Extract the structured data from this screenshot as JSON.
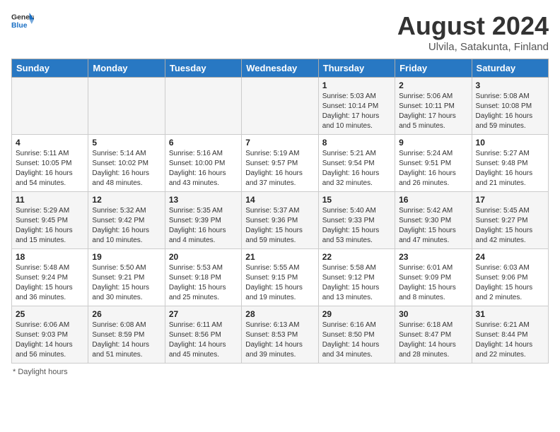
{
  "header": {
    "logo_general": "General",
    "logo_blue": "Blue",
    "title": "August 2024",
    "subtitle": "Ulvila, Satakunta, Finland"
  },
  "days_of_week": [
    "Sunday",
    "Monday",
    "Tuesday",
    "Wednesday",
    "Thursday",
    "Friday",
    "Saturday"
  ],
  "footer": {
    "daylight_hours_label": "Daylight hours"
  },
  "weeks": [
    [
      {
        "num": "",
        "info": ""
      },
      {
        "num": "",
        "info": ""
      },
      {
        "num": "",
        "info": ""
      },
      {
        "num": "",
        "info": ""
      },
      {
        "num": "1",
        "info": "Sunrise: 5:03 AM\nSunset: 10:14 PM\nDaylight: 17 hours\nand 10 minutes."
      },
      {
        "num": "2",
        "info": "Sunrise: 5:06 AM\nSunset: 10:11 PM\nDaylight: 17 hours\nand 5 minutes."
      },
      {
        "num": "3",
        "info": "Sunrise: 5:08 AM\nSunset: 10:08 PM\nDaylight: 16 hours\nand 59 minutes."
      }
    ],
    [
      {
        "num": "4",
        "info": "Sunrise: 5:11 AM\nSunset: 10:05 PM\nDaylight: 16 hours\nand 54 minutes."
      },
      {
        "num": "5",
        "info": "Sunrise: 5:14 AM\nSunset: 10:02 PM\nDaylight: 16 hours\nand 48 minutes."
      },
      {
        "num": "6",
        "info": "Sunrise: 5:16 AM\nSunset: 10:00 PM\nDaylight: 16 hours\nand 43 minutes."
      },
      {
        "num": "7",
        "info": "Sunrise: 5:19 AM\nSunset: 9:57 PM\nDaylight: 16 hours\nand 37 minutes."
      },
      {
        "num": "8",
        "info": "Sunrise: 5:21 AM\nSunset: 9:54 PM\nDaylight: 16 hours\nand 32 minutes."
      },
      {
        "num": "9",
        "info": "Sunrise: 5:24 AM\nSunset: 9:51 PM\nDaylight: 16 hours\nand 26 minutes."
      },
      {
        "num": "10",
        "info": "Sunrise: 5:27 AM\nSunset: 9:48 PM\nDaylight: 16 hours\nand 21 minutes."
      }
    ],
    [
      {
        "num": "11",
        "info": "Sunrise: 5:29 AM\nSunset: 9:45 PM\nDaylight: 16 hours\nand 15 minutes."
      },
      {
        "num": "12",
        "info": "Sunrise: 5:32 AM\nSunset: 9:42 PM\nDaylight: 16 hours\nand 10 minutes."
      },
      {
        "num": "13",
        "info": "Sunrise: 5:35 AM\nSunset: 9:39 PM\nDaylight: 16 hours\nand 4 minutes."
      },
      {
        "num": "14",
        "info": "Sunrise: 5:37 AM\nSunset: 9:36 PM\nDaylight: 15 hours\nand 59 minutes."
      },
      {
        "num": "15",
        "info": "Sunrise: 5:40 AM\nSunset: 9:33 PM\nDaylight: 15 hours\nand 53 minutes."
      },
      {
        "num": "16",
        "info": "Sunrise: 5:42 AM\nSunset: 9:30 PM\nDaylight: 15 hours\nand 47 minutes."
      },
      {
        "num": "17",
        "info": "Sunrise: 5:45 AM\nSunset: 9:27 PM\nDaylight: 15 hours\nand 42 minutes."
      }
    ],
    [
      {
        "num": "18",
        "info": "Sunrise: 5:48 AM\nSunset: 9:24 PM\nDaylight: 15 hours\nand 36 minutes."
      },
      {
        "num": "19",
        "info": "Sunrise: 5:50 AM\nSunset: 9:21 PM\nDaylight: 15 hours\nand 30 minutes."
      },
      {
        "num": "20",
        "info": "Sunrise: 5:53 AM\nSunset: 9:18 PM\nDaylight: 15 hours\nand 25 minutes."
      },
      {
        "num": "21",
        "info": "Sunrise: 5:55 AM\nSunset: 9:15 PM\nDaylight: 15 hours\nand 19 minutes."
      },
      {
        "num": "22",
        "info": "Sunrise: 5:58 AM\nSunset: 9:12 PM\nDaylight: 15 hours\nand 13 minutes."
      },
      {
        "num": "23",
        "info": "Sunrise: 6:01 AM\nSunset: 9:09 PM\nDaylight: 15 hours\nand 8 minutes."
      },
      {
        "num": "24",
        "info": "Sunrise: 6:03 AM\nSunset: 9:06 PM\nDaylight: 15 hours\nand 2 minutes."
      }
    ],
    [
      {
        "num": "25",
        "info": "Sunrise: 6:06 AM\nSunset: 9:03 PM\nDaylight: 14 hours\nand 56 minutes."
      },
      {
        "num": "26",
        "info": "Sunrise: 6:08 AM\nSunset: 8:59 PM\nDaylight: 14 hours\nand 51 minutes."
      },
      {
        "num": "27",
        "info": "Sunrise: 6:11 AM\nSunset: 8:56 PM\nDaylight: 14 hours\nand 45 minutes."
      },
      {
        "num": "28",
        "info": "Sunrise: 6:13 AM\nSunset: 8:53 PM\nDaylight: 14 hours\nand 39 minutes."
      },
      {
        "num": "29",
        "info": "Sunrise: 6:16 AM\nSunset: 8:50 PM\nDaylight: 14 hours\nand 34 minutes."
      },
      {
        "num": "30",
        "info": "Sunrise: 6:18 AM\nSunset: 8:47 PM\nDaylight: 14 hours\nand 28 minutes."
      },
      {
        "num": "31",
        "info": "Sunrise: 6:21 AM\nSunset: 8:44 PM\nDaylight: 14 hours\nand 22 minutes."
      }
    ]
  ]
}
